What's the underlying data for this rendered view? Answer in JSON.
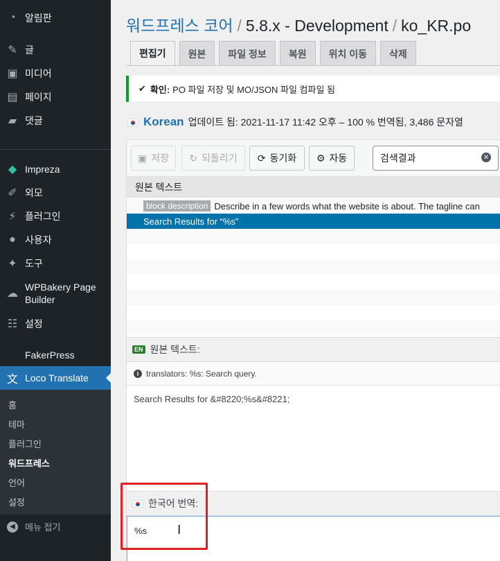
{
  "sidebar": {
    "items": [
      {
        "label": "알림판",
        "icon": "dashboard-icon",
        "glyph": "◔"
      },
      {
        "label": "글",
        "icon": "pin-icon",
        "glyph": "✎"
      },
      {
        "label": "미디어",
        "icon": "media-icon",
        "glyph": "▣"
      },
      {
        "label": "페이지",
        "icon": "page-icon",
        "glyph": "▤"
      },
      {
        "label": "댓글",
        "icon": "comment-icon",
        "glyph": "▰"
      },
      {
        "label": "Impreza",
        "icon": "diamond-icon",
        "glyph": "◆"
      },
      {
        "label": "외모",
        "icon": "brush-icon",
        "glyph": "✐"
      },
      {
        "label": "플러그인",
        "icon": "plugin-icon",
        "glyph": "⚡"
      },
      {
        "label": "사용자",
        "icon": "user-icon",
        "glyph": "●"
      },
      {
        "label": "도구",
        "icon": "wrench-icon",
        "glyph": "✦"
      },
      {
        "label": "WPBakery Page Builder",
        "icon": "cloud-icon",
        "glyph": "☁"
      },
      {
        "label": "설정",
        "icon": "settings-icon",
        "glyph": "☷"
      },
      {
        "label": "FakerPress",
        "icon": "",
        "glyph": ""
      }
    ],
    "loco": {
      "label": "Loco Translate",
      "icon": "translate-icon",
      "glyph": "文"
    },
    "submenu": [
      "홈",
      "테마",
      "플러그인",
      "워드프레스",
      "언어",
      "설정"
    ],
    "active_submenu": "워드프레스",
    "collapse_label": "메뉴 접기"
  },
  "title": {
    "project": "워드프레스 코어",
    "version": "5.8.x - Development",
    "file": "ko_KR.po",
    "sep": "/"
  },
  "tabs": [
    "편집기",
    "원본",
    "파일 정보",
    "복원",
    "위치 이동",
    "삭제"
  ],
  "active_tab": "편집기",
  "notice": {
    "label": "확인:",
    "text": "PO 파일 저장 및 MO/JSON 파일 컴파일 됨"
  },
  "status": {
    "language": "Korean",
    "text": "업데이트 됨: 2021-11-17 11:42 오후 – 100 % 번역됨, 3,486 문자열"
  },
  "toolbar": {
    "save": "저장",
    "revert": "되돌리기",
    "sync": "동기화",
    "auto": "자동",
    "search_value": "검색결과"
  },
  "list": {
    "header": "원본 텍스트",
    "rows": [
      {
        "context": "block description",
        "text": "Describe in a few words what the website is about. The tagline can"
      },
      {
        "context": "",
        "text": "Search Results for “%s”"
      }
    ]
  },
  "source_pane": {
    "badge": "EN",
    "label": "원본 텍스트:",
    "comment": "translators: %s: Search query.",
    "text": "Search Results for &#8220;%s&#8221;"
  },
  "target_pane": {
    "label": "한국어 번역:",
    "value": "%s"
  },
  "colors": {
    "sidebar_bg": "#1d2327",
    "accent": "#2271b1",
    "selected_row": "#0073aa",
    "success": "#00a32a",
    "highlight": "#e02020"
  }
}
